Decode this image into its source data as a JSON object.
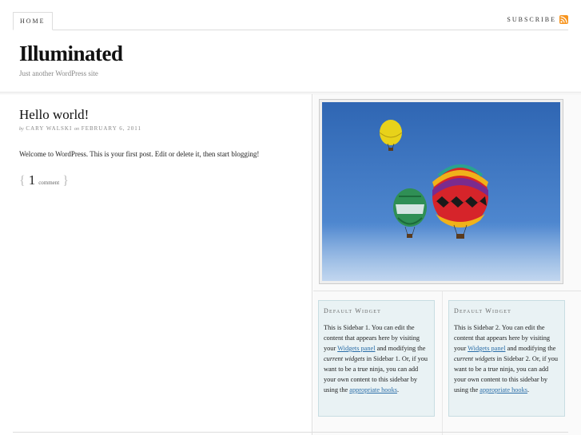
{
  "nav": {
    "home_label": "HOME",
    "subscribe_label": "SUBSCRIBE",
    "rss_icon": "rss-icon"
  },
  "header": {
    "site_title": "Illuminated",
    "site_description": "Just another WordPress site"
  },
  "post": {
    "title": "Hello world!",
    "meta_by": "by",
    "author": "CARY WALSKI",
    "meta_on": "on",
    "date": "FEBRUARY 6, 2011",
    "body": "Welcome to WordPress. This is your first post. Edit or delete it, then start blogging!",
    "comment_count": "1",
    "comment_word": "comment",
    "brace_open": "{",
    "brace_close": "}"
  },
  "sidebar": {
    "image": "hot-air-balloons-photo",
    "widgets": [
      {
        "title": "Default Widget",
        "text_1": "This is Sidebar 1. You can edit the content that appears here by visiting your ",
        "link_1": "Widgets panel",
        "text_2": " and modifying the ",
        "em": "current widgets",
        "text_3": " in Sidebar 1. Or, if you want to be a true ninja, you can add your own content to this sidebar by using the ",
        "link_2": "appropriate hooks",
        "text_4": "."
      },
      {
        "title": "Default Widget",
        "text_1": "This is Sidebar 2. You can edit the content that appears here by visiting your ",
        "link_1": "Widgets panel",
        "text_2": " and modifying the ",
        "em": "current widgets",
        "text_3": " in Sidebar 2. Or, if you want to be a true ninja, you can add your own content to this sidebar by using the ",
        "link_2": "appropriate hooks",
        "text_4": "."
      }
    ]
  },
  "colors": {
    "link": "#2b6ea8",
    "widget_bg": "#e9f2f4",
    "rss": "#f7941e",
    "sky": "#3f78c4"
  }
}
